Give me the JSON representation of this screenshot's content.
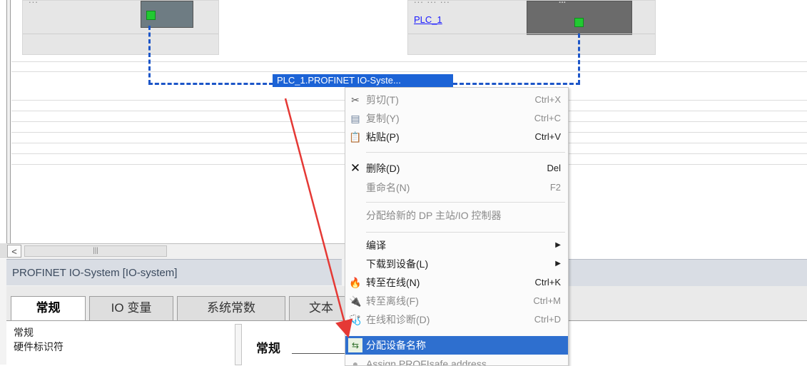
{
  "network": {
    "left_device_header": "...",
    "right_device_header": "... ... ...",
    "right_module_header": "...",
    "right_device_link": "PLC_1",
    "subnet_label": "PLC_1.PROFINET IO-Syste..."
  },
  "scrollbar": {
    "left_arrow": "<",
    "thumb_grip": "|||"
  },
  "inspector": {
    "title": "PROFINET IO-System [IO-system]",
    "tabs": [
      "常规",
      "IO 变量",
      "系统常数",
      "文本"
    ],
    "side_items": [
      "常规",
      "硬件标识符"
    ],
    "heading": "常规"
  },
  "context_menu": {
    "items": [
      {
        "icon": "✂",
        "label": "剪切(T)",
        "shortcut": "Ctrl+X",
        "disabled": true
      },
      {
        "icon": "▤",
        "label": "复制(Y)",
        "shortcut": "Ctrl+C",
        "disabled": true
      },
      {
        "icon": "📋",
        "label": "粘贴(P)",
        "shortcut": "Ctrl+V",
        "disabled": false
      },
      {
        "icon": "✕",
        "label": "删除(D)",
        "shortcut": "Del",
        "disabled": false
      },
      {
        "icon": "",
        "label": "重命名(N)",
        "shortcut": "F2",
        "disabled": true
      },
      {
        "icon": "",
        "label": "分配给新的 DP 主站/IO 控制器",
        "shortcut": "",
        "disabled": true
      },
      {
        "icon": "",
        "label": "编译",
        "shortcut": "",
        "disabled": false,
        "submenu": true
      },
      {
        "icon": "",
        "label": "下载到设备(L)",
        "shortcut": "",
        "disabled": false,
        "submenu": true
      },
      {
        "icon": "🔥",
        "label": "转至在线(N)",
        "shortcut": "Ctrl+K",
        "disabled": false
      },
      {
        "icon": "🔌",
        "label": "转至离线(F)",
        "shortcut": "Ctrl+M",
        "disabled": true
      },
      {
        "icon": "🩺",
        "label": "在线和诊断(D)",
        "shortcut": "Ctrl+D",
        "disabled": true
      },
      {
        "icon": "⇆",
        "label": "分配设备名称",
        "shortcut": "",
        "disabled": false,
        "highlighted": true
      },
      {
        "icon": "●",
        "label": "Assign PROFIsafe address",
        "shortcut": "",
        "disabled": true
      }
    ]
  },
  "colors": {
    "network_line": "#1d56c8",
    "port_green": "#22c932",
    "menu_highlight": "#2e6fcf",
    "annotation_arrow": "#e53935"
  }
}
